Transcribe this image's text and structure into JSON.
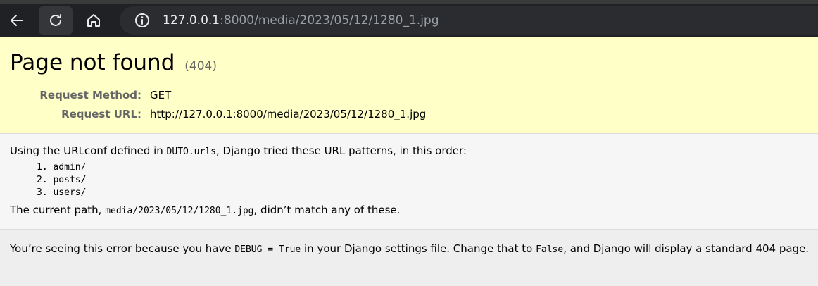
{
  "browser": {
    "url_host": "127.0.0.1",
    "url_rest": ":8000/media/2023/05/12/1280_1.jpg",
    "icons": {
      "back": "back-arrow-icon",
      "reload": "reload-icon",
      "home": "home-icon",
      "info": "info-icon"
    }
  },
  "summary": {
    "title": "Page not found",
    "status_code": "(404)",
    "rows": [
      {
        "label": "Request Method:",
        "value": "GET"
      },
      {
        "label": "Request URL:",
        "value": "http://127.0.0.1:8000/media/2023/05/12/1280_1.jpg"
      }
    ]
  },
  "info": {
    "intro_prefix": "Using the URLconf defined in ",
    "urlconf": "DUTO.urls",
    "intro_suffix": ", Django tried these URL patterns, in this order:",
    "patterns": [
      "1. admin/",
      "2. posts/",
      "3. users/"
    ],
    "current_prefix": "The current path, ",
    "current_path": "media/2023/05/12/1280_1.jpg",
    "current_suffix": ", didn’t match any of these."
  },
  "explanation": {
    "part1": "You’re seeing this error because you have ",
    "code1": "DEBUG = True",
    "part2": " in your Django settings file. Change that to ",
    "code2": "False",
    "part3": ", and Django will display a standard 404 page."
  }
}
